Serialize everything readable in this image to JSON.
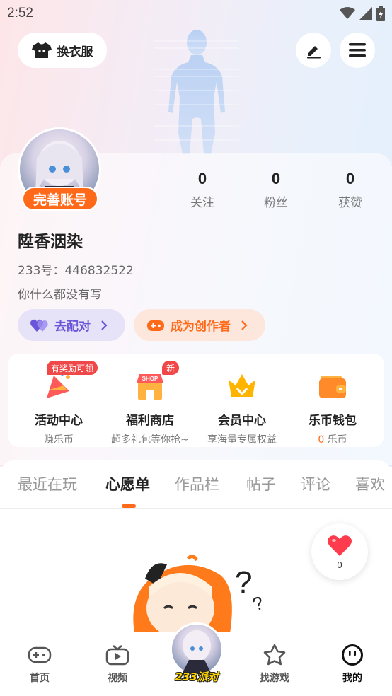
{
  "status_bar": {
    "time": "2:52"
  },
  "header": {
    "wardrobe_label": "换衣服",
    "edit_icon": "pencil-icon",
    "menu_icon": "hamburger-menu-icon"
  },
  "profile": {
    "complete_badge": "完善账号",
    "stats": [
      {
        "value": "0",
        "label": "关注"
      },
      {
        "value": "0",
        "label": "粉丝"
      },
      {
        "value": "0",
        "label": "获赞"
      }
    ],
    "username": "陞香洇染",
    "uid": "233号：446832522",
    "bio": "你什么都没有写",
    "match_button": "去配对",
    "creator_button": "成为创作者"
  },
  "quick_entries": [
    {
      "title": "活动中心",
      "subtitle": "赚乐币",
      "tag": "有奖励可领"
    },
    {
      "title": "福利商店",
      "subtitle": "超多礼包等你抢~",
      "tag": "新"
    },
    {
      "title": "会员中心",
      "subtitle": "享海量专属权益"
    },
    {
      "title": "乐币钱包",
      "subtitle_value": "0",
      "subtitle_unit": "乐币"
    }
  ],
  "tabs": [
    {
      "label": "最近在玩"
    },
    {
      "label": "心愿单"
    },
    {
      "label": "作品栏"
    },
    {
      "label": "帖子"
    },
    {
      "label": "评论"
    },
    {
      "label": "喜欢"
    }
  ],
  "active_tab": "心愿单",
  "like_float": {
    "count": "0"
  },
  "bottom_nav": [
    {
      "label": "首页"
    },
    {
      "label": "视频"
    },
    {
      "label": "233派对"
    },
    {
      "label": "找游戏"
    },
    {
      "label": "我的"
    }
  ],
  "colors": {
    "accent": "#ff6a1a",
    "match_purple": "#6a55d8",
    "tag_red": "#f04848"
  }
}
